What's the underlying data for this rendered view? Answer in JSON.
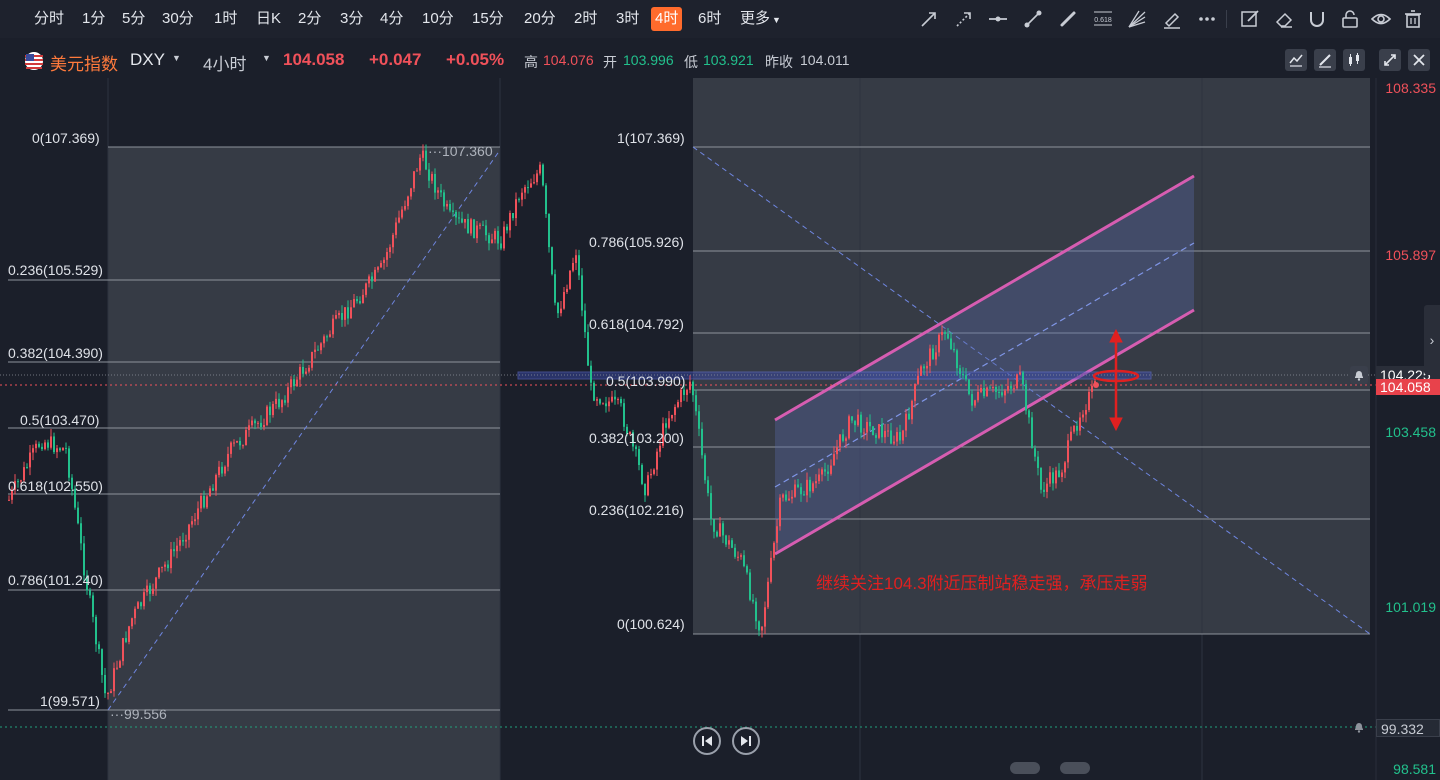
{
  "timeframes": [
    "分时",
    "1分",
    "5分",
    "30分",
    "1时",
    "日K",
    "2分",
    "3分",
    "4分",
    "10分",
    "15分",
    "20分",
    "2时",
    "3时",
    "4时",
    "6时",
    "更多"
  ],
  "active_timeframe": "4时",
  "symbol": {
    "name": "美元指数",
    "code": "DXY",
    "period": "4小时",
    "price": "104.058",
    "change": "+0.047",
    "change_pct": "+0.05%",
    "high_label": "高",
    "high": "104.076",
    "open_label": "开",
    "open": "103.996",
    "low_label": "低",
    "low": "103.921",
    "prev_label": "昨收",
    "prev": "104.011"
  },
  "price_axis": {
    "ticks": [
      {
        "value": "108.335",
        "color": "#f0515a"
      },
      {
        "value": "105.897",
        "color": "#f0515a"
      },
      {
        "value": "103.458",
        "color": "#22c08c"
      },
      {
        "value": "101.019",
        "color": "#22c08c"
      },
      {
        "value": "98.581",
        "color": "#22c08c"
      }
    ],
    "crosshair_price": "104.225",
    "last_price": "104.058",
    "alert_price": "99.332"
  },
  "left_fib": {
    "labels": [
      "0(107.369)",
      "0.236(105.529)",
      "0.382(104.390)",
      "0.5(103.470)",
      "0.618(102.550)",
      "0.786(101.240)",
      "1(99.571)"
    ],
    "high_mark": "107.360",
    "low_mark": "99.556"
  },
  "right_fib": {
    "labels": [
      "1(107.369)",
      "0.786(105.926)",
      "0.618(104.792)",
      "0.5(103.990)",
      "0.382(103.200)",
      "0.236(102.216)",
      "0(100.624)"
    ]
  },
  "annotation": "继续关注104.3附近压制站稳走强，承压走弱",
  "colors": {
    "up": "#f0515a",
    "down": "#22c08c",
    "accent": "#ff6b2c",
    "channel": "#d65db1",
    "annotation": "#e02020"
  },
  "toolbar_icons": [
    "trend-line-icon",
    "ray-icon",
    "horizontal-line-icon",
    "segment-icon",
    "brush-icon",
    "fib-icon",
    "fan-icon",
    "highlighter-icon",
    "more-dots-icon",
    "edit-icon",
    "eraser-icon",
    "magnet-icon",
    "lock-icon",
    "eye-icon",
    "trash-icon"
  ],
  "fib_tool_label": "0.618"
}
